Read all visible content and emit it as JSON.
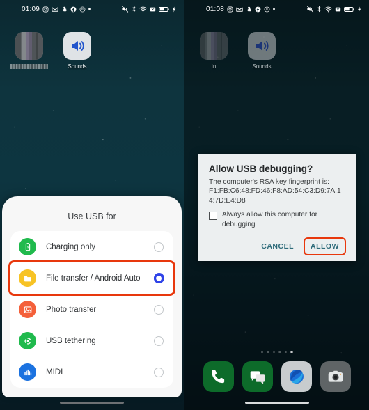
{
  "left_panel": {
    "statusbar": {
      "clock": "01:09",
      "notification_icons": [
        "instagram-icon",
        "gmail-icon",
        "snapchat-icon",
        "facebook-icon",
        "app-badge-icon",
        "more-dot-icon"
      ],
      "system_icons": [
        "mute-icon",
        "bluetooth-icon",
        "wifi-icon",
        "sim-icon",
        "battery-icon",
        "charging-bolt-icon"
      ]
    },
    "home_apps": [
      {
        "label": "",
        "icon": "censored-app-icon",
        "censored": true
      },
      {
        "label": "Sounds",
        "icon": "speaker-icon",
        "censored": false
      }
    ],
    "usb_sheet": {
      "title": "Use USB for",
      "options": [
        {
          "label": "Charging only",
          "icon": "battery-charge-icon",
          "selected": false,
          "highlighted": false
        },
        {
          "label": "File transfer / Android Auto",
          "icon": "folder-icon",
          "selected": true,
          "highlighted": true
        },
        {
          "label": "Photo transfer",
          "icon": "photo-icon",
          "selected": false,
          "highlighted": false
        },
        {
          "label": "USB tethering",
          "icon": "tethering-icon",
          "selected": false,
          "highlighted": false
        },
        {
          "label": "MIDI",
          "icon": "midi-icon",
          "selected": false,
          "highlighted": false
        }
      ]
    }
  },
  "right_panel": {
    "statusbar": {
      "clock": "01:08",
      "notification_icons": [
        "instagram-icon",
        "gmail-icon",
        "snapchat-icon",
        "facebook-icon",
        "app-badge-icon",
        "more-dot-icon"
      ],
      "system_icons": [
        "mute-icon",
        "bluetooth-icon",
        "wifi-icon",
        "sim-icon",
        "battery-icon",
        "charging-bolt-icon"
      ]
    },
    "home_apps": [
      {
        "label": "In",
        "icon": "censored-app-icon",
        "censored": true
      },
      {
        "label": "Sounds",
        "icon": "speaker-icon",
        "censored": false
      }
    ],
    "page_dots": {
      "count": 6,
      "active_index": 5
    },
    "dock": [
      {
        "label": "Phone",
        "icon": "phone-icon"
      },
      {
        "label": "Messages",
        "icon": "messages-icon"
      },
      {
        "label": "Browser",
        "icon": "browser-icon"
      },
      {
        "label": "Camera",
        "icon": "camera-icon"
      }
    ],
    "debug_dialog": {
      "title": "Allow USB debugging?",
      "body": "The computer's RSA key fingerprint is:",
      "fingerprint": "F1:FB:C6:48:FD:46:F8:AD:54:C3:D9:7A:14:7D:E4:D8",
      "checkbox_label": "Always allow this computer for debugging",
      "checkbox_checked": false,
      "cancel_label": "CANCEL",
      "allow_label": "ALLOW",
      "allow_highlighted": true
    }
  },
  "colors": {
    "highlight_red": "#e8380d",
    "radio_selected_blue": "#2f43e8",
    "dialog_button_teal": "#2e6b7a",
    "wallpaper_teal": "#0d3540",
    "icon_green": "#20ba4d",
    "icon_yellow": "#f7c325",
    "icon_orange": "#f4603a",
    "icon_blue": "#1b72e0"
  }
}
